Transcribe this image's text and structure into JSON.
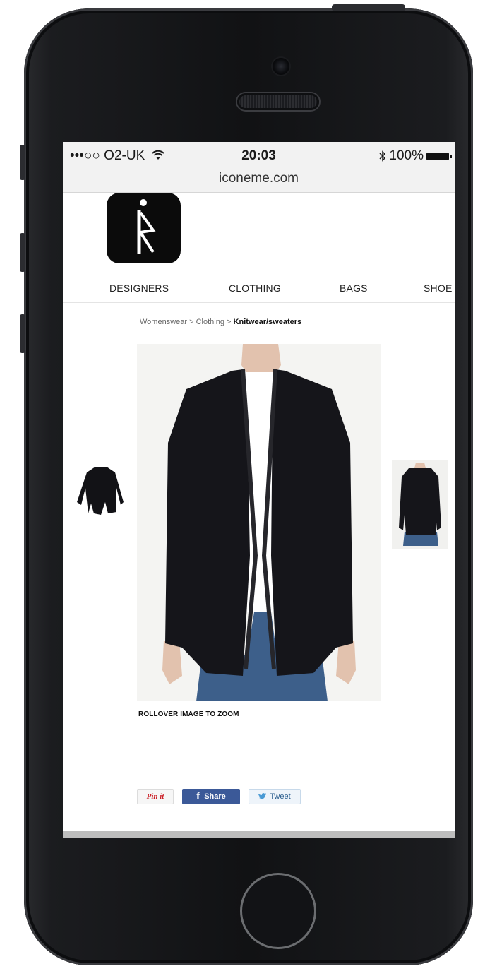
{
  "device": {
    "name": "iPhone"
  },
  "status_bar": {
    "carrier": "•••○○ O2-UK",
    "time": "20:03",
    "battery": "100%",
    "icons": [
      "wifi-icon",
      "bluetooth-icon",
      "battery-icon"
    ]
  },
  "browser": {
    "url": "iconeme.com"
  },
  "logo": {
    "icon": "iconeme-logo"
  },
  "nav": {
    "items": [
      {
        "label": "DESIGNERS"
      },
      {
        "label": "CLOTHING"
      },
      {
        "label": "BAGS"
      },
      {
        "label": "SHOE"
      }
    ]
  },
  "breadcrumb": {
    "parts": [
      "Womenswear",
      "Clothing"
    ],
    "separator": ">",
    "current": "Knitwear/sweaters"
  },
  "product": {
    "zoom_note": "ROLLOVER IMAGE TO ZOOM",
    "colors": {
      "garment": "#15151a",
      "denim": "#3d5f8a",
      "skin": "#e2c2ae"
    }
  },
  "share": {
    "pinterest": "Pin it",
    "facebook": "Share",
    "twitter": "Tweet"
  }
}
